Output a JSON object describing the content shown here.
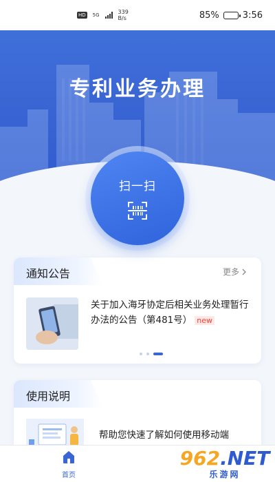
{
  "status_bar": {
    "hd": "HD",
    "network": "5G",
    "speed_value": "339",
    "speed_unit": "B/s",
    "battery_percent": "85%",
    "battery_level": 0.85,
    "time": "3:56"
  },
  "hero": {
    "title": "专利业务办理"
  },
  "scan": {
    "label": "扫一扫",
    "icon": "scan-barcode-icon"
  },
  "notice": {
    "title": "通知公告",
    "more": "更多",
    "items": [
      {
        "text": "关于加入海牙协定后相关业务处理暂行办法的公告（第481号）",
        "badge": "new"
      }
    ],
    "carousel": {
      "count": 3,
      "active": 2
    }
  },
  "guide": {
    "title": "使用说明",
    "items": [
      {
        "text": "帮助您快速了解如何使用移动端"
      }
    ]
  },
  "tab_bar": {
    "home_label": "首页"
  },
  "watermark": {
    "main_a": "9",
    "main_b": "62",
    "main_c": ".NET",
    "sub": "乐游网"
  },
  "colors": {
    "primary": "#3a66d4",
    "new_badge": "#ff3b2f"
  }
}
